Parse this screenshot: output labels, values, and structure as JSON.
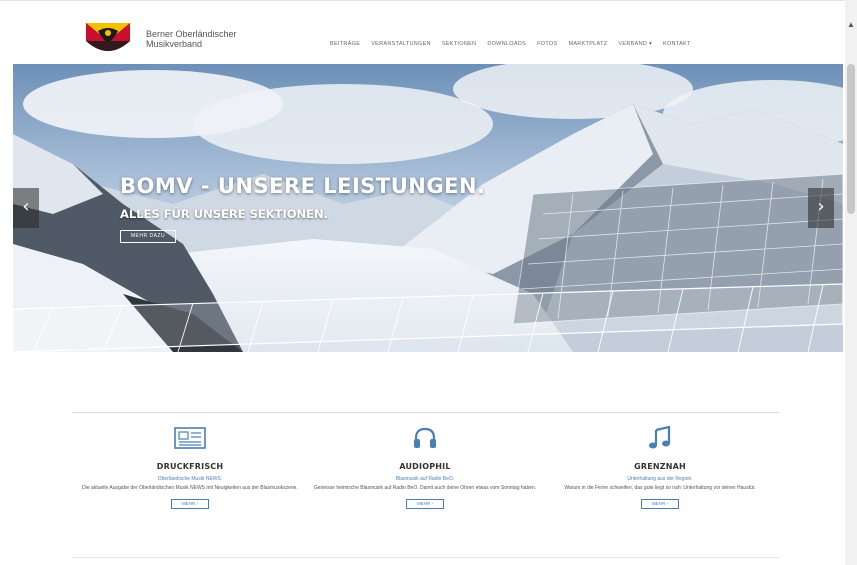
{
  "header": {
    "brand_line1": "Berner Oberländischer",
    "brand_line2": "Musikverband",
    "nav": [
      "BEITRÄGE",
      "VERANSTALTUNGEN",
      "SEKTIONEN",
      "DOWNLOADS",
      "FOTOS",
      "MARKTPLATZ",
      "VERBAND ▾",
      "KONTAKT"
    ]
  },
  "hero": {
    "title": "BOMV - UNSERE LEISTUNGEN.",
    "subtitle": "ALLES FÜR UNSERE SEKTIONEN.",
    "button": "MEHR DAZU",
    "prev": "‹",
    "next": "›"
  },
  "features": [
    {
      "icon": "newspaper-icon",
      "title": "DRUCKFRISCH",
      "tag": "Oberländische Musik NEWS.",
      "desc": "Die aktuelle Ausgabe der Oberländischen Musik NEWS mit Neuigkeiten aus der Blasmusikszene.",
      "button": "MEHR ›"
    },
    {
      "icon": "headphones-icon",
      "title": "AUDIOPHIL",
      "tag": "Blasmusik auf Radio BeO.",
      "desc": "Geniesse heimische Blasmusik auf Radio BeO. Damit auch deine Ohren etwas vom Sonntag haben.",
      "button": "MEHR ›"
    },
    {
      "icon": "music-note-icon",
      "title": "GRENZNAH",
      "tag": "Unterhaltung aus der Region.",
      "desc": "Warum in die Ferne schweifen, das gute liegt so nah: Unterhaltung vor deiner Haustür.",
      "button": "MEHR ›"
    }
  ],
  "colors": {
    "accent": "#4a7fb5",
    "coat_red": "#c8102e",
    "coat_yellow": "#f2c200"
  }
}
